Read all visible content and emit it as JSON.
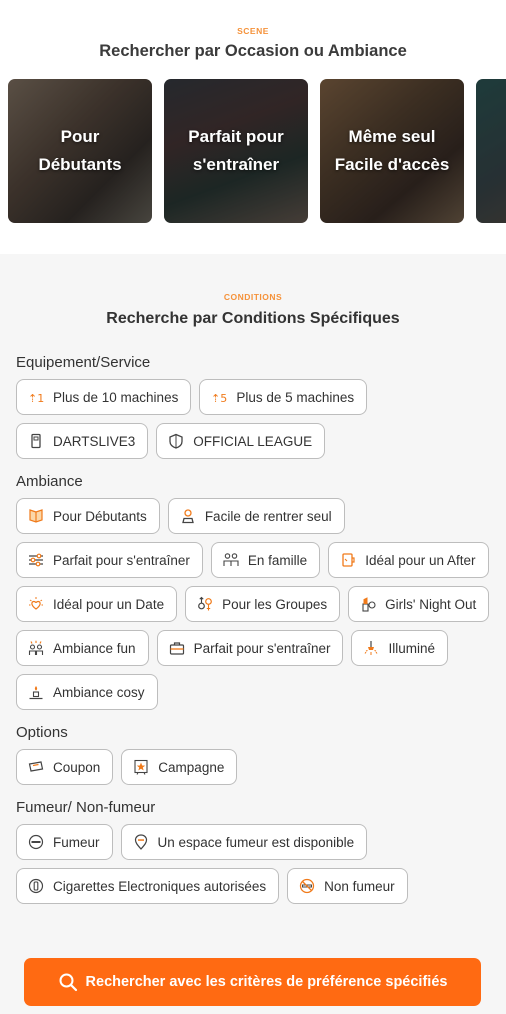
{
  "scene": {
    "eyebrow": "SCENE",
    "title": "Rechercher par Occasion ou Ambiance",
    "cards": [
      {
        "line1": "Pour",
        "line2": "Débutants"
      },
      {
        "line1": "Parfait pour",
        "line2": "s'entraîner"
      },
      {
        "line1": "Même seul",
        "line2": "Facile d'accès"
      }
    ]
  },
  "conditions": {
    "eyebrow": "CONDITIONS",
    "title": "Recherche par Conditions Spécifiques",
    "groups": [
      {
        "title": "Equipement/Service",
        "chips": [
          "Plus de 10 machines",
          "Plus de 5 machines",
          "DARTSLIVE3",
          "OFFICIAL LEAGUE"
        ]
      },
      {
        "title": "Ambiance",
        "chips": [
          "Pour Débutants",
          "Facile de rentrer seul",
          "Parfait pour s'entraîner",
          "En famille",
          "Idéal pour un After",
          "Idéal pour un Date",
          "Pour les Groupes",
          "Girls' Night Out",
          "Ambiance fun",
          "Parfait pour s'entraîner",
          "Illuminé",
          "Ambiance cosy"
        ]
      },
      {
        "title": "Options",
        "chips": [
          "Coupon",
          "Campagne"
        ]
      },
      {
        "title": "Fumeur/ Non-fumeur",
        "chips": [
          "Fumeur",
          "Un espace fumeur est disponible",
          "Cigarettes Electroniques autorisées",
          "Non fumeur"
        ]
      }
    ]
  },
  "search_button": {
    "label": "Rechercher avec les critères de préférence spécifiés"
  },
  "colors": {
    "accent": "#ff6a12",
    "eyebrow": "#f5923a"
  }
}
